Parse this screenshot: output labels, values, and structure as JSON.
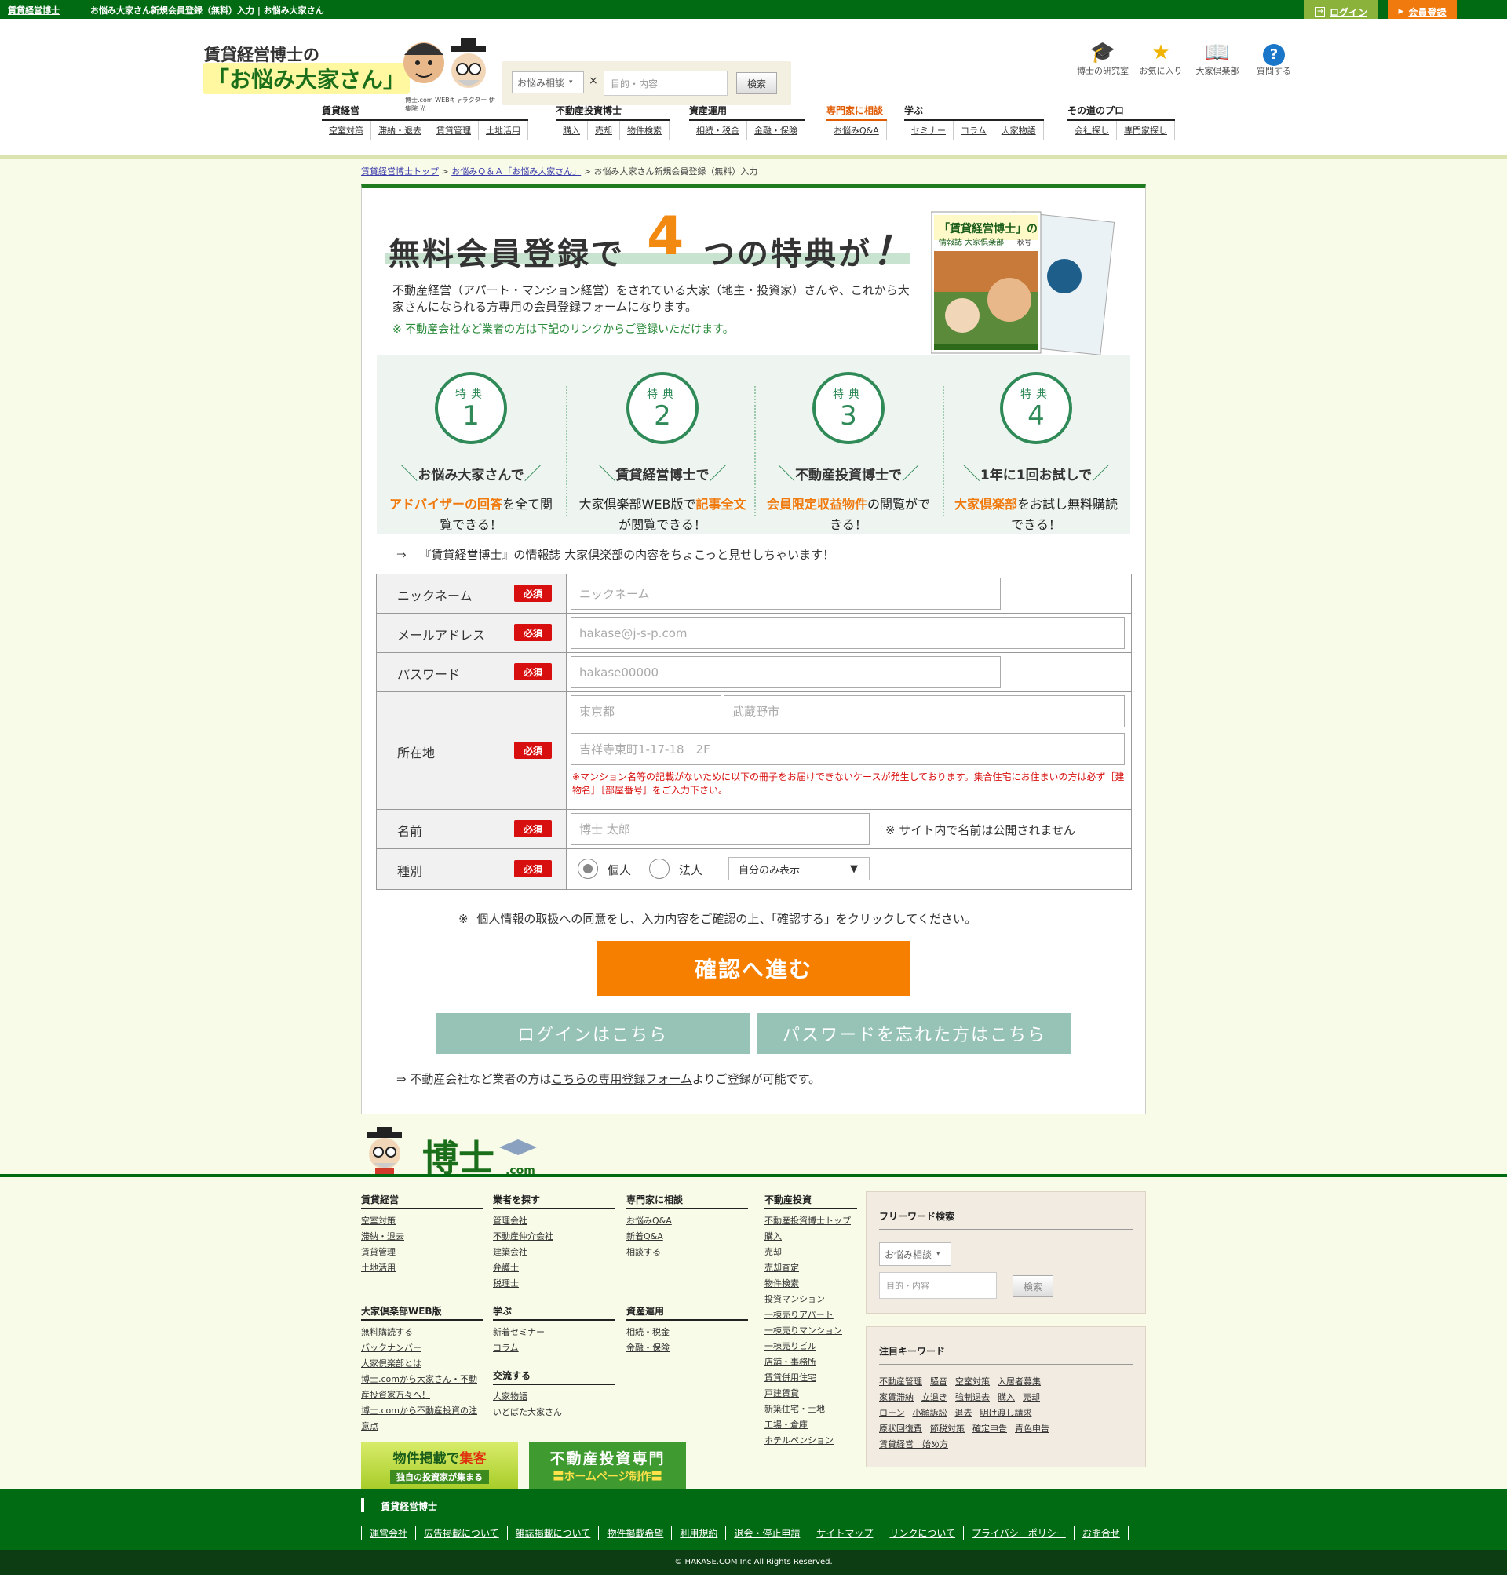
{
  "topbar": {
    "site_link": "賃貸経営博士",
    "page_title": "お悩み大家さん新規会員登録（無料）入力 | お悩み大家さん",
    "login": "ログイン",
    "register": "会員登録"
  },
  "header": {
    "logo_line1": "賃貸経営博士の",
    "logo_line2": "「お悩み大家さん」",
    "char_caption": "博士.com WEBキャラクター 伊集院 光",
    "search": {
      "select_value": "お悩み相談",
      "x_mark": "×",
      "placeholder": "目的・内容",
      "button": "検索"
    },
    "icons": [
      {
        "label": "博士の研究室",
        "icon": "mortarboard-icon"
      },
      {
        "label": "お気に入り",
        "icon": "star-icon"
      },
      {
        "label": "大家倶楽部",
        "icon": "book-icon"
      },
      {
        "label": "質問する",
        "icon": "question-icon"
      }
    ],
    "nav": [
      {
        "category": "賃貸経営",
        "items": [
          "空室対策",
          "滞納・退去",
          "賃貸管理",
          "土地活用"
        ]
      },
      {
        "category": "不動産投資博士",
        "items": [
          "購入",
          "売却",
          "物件検索"
        ]
      },
      {
        "category": "資産運用",
        "items": [
          "相続・税金",
          "金融・保険"
        ]
      },
      {
        "category": "専門家に相談",
        "items": [
          "お悩みQ&A"
        ]
      },
      {
        "category": "学ぶ",
        "items": [
          "セミナー",
          "コラム",
          "大家物語"
        ]
      },
      {
        "category": "その道のプロ",
        "items": [
          "会社探し",
          "専門家探し"
        ]
      }
    ]
  },
  "breadcrumb": {
    "home": "賃貸経営博士トップ",
    "qa": "お悩みＱ＆Ａ「お悩み大家さん」",
    "current": "お悩み大家さん新規会員登録（無料）入力",
    "sep": ">"
  },
  "hero": {
    "title_pre": "無料会員登録で",
    "title_num": "4",
    "title_post": "つの特典が",
    "title_bang": "！",
    "desc": "不動産経営（アパート・マンション経営）をされている大家（地主・投資家）さんや、これから大家さんになられる方専用の会員登録フォームになります。",
    "note": "※ 不動産会社など業者の方は下記のリンクからご登録いただけます。",
    "magazine_title": "「賃貸経営博士」の",
    "magazine_sub": "情報誌 大家倶楽部",
    "magazine_issue": "秋号"
  },
  "benefits": [
    {
      "label": "特典",
      "num": "1",
      "head": "お悩み大家さんで",
      "body_hl": "アドバイザーの回答",
      "body": "を全て閲覧できる！"
    },
    {
      "label": "特典",
      "num": "2",
      "head": "賃貸経営博士で",
      "body_pre": "大家倶楽部WEB版で",
      "body_hl": "記事全文",
      "body": "が閲覧できる！"
    },
    {
      "label": "特典",
      "num": "3",
      "head": "不動産投資博士で",
      "body_hl": "会員限定収益物件",
      "body": "の閲覧ができる！"
    },
    {
      "label": "特典",
      "num": "4",
      "head": "1年に1回お試しで",
      "body_hl": "大家倶楽部",
      "body": "をお試し無料購読できる！"
    }
  ],
  "peek": {
    "arrow": "⇒",
    "link": "『賃貸経営博士』の情報誌 大家倶楽部の内容をちょこっと見せしちゃいます！"
  },
  "form": {
    "required": "必須",
    "nickname": {
      "label": "ニックネーム",
      "placeholder": "ニックネーム"
    },
    "email": {
      "label": "メールアドレス",
      "placeholder": "hakase@j-s-p.com"
    },
    "password": {
      "label": "パスワード",
      "placeholder": "hakase00000"
    },
    "address": {
      "label": "所在地",
      "pref_placeholder": "東京都",
      "city_placeholder": "武蔵野市",
      "street_placeholder": "吉祥寺東町1-17-18　2F",
      "warning": "※マンション名等の記載がないために以下の冊子をお届けできないケースが発生しております。集合住宅にお住まいの方は必ず［建物名］［部屋番号］をご入力下さい。"
    },
    "name": {
      "label": "名前",
      "placeholder": "博士 太郎",
      "note": "※ サイト内で名前は公開されません"
    },
    "type": {
      "label": "種別",
      "opt_personal": "個人",
      "opt_corp": "法人",
      "visibility": "自分のみ表示"
    }
  },
  "agree": {
    "pre": "※",
    "link": "個人情報の取扱",
    "post": "への同意をし、入力内容をご確認の上、「確認する」をクリックしてください。"
  },
  "buttons": {
    "confirm": "確認へ進む",
    "login": "ログインはこちら",
    "forgot": "パスワードを忘れた方はこちら"
  },
  "business": {
    "pre": "⇒ 不動産会社など業者の方は",
    "link": "こちらの専用登録フォーム",
    "post": "よりご登録が可能です。"
  },
  "footer": {
    "logo_text": "博士",
    "logo_com": ".com",
    "col1": [
      {
        "title": "賃貸経営",
        "links": [
          "空室対策",
          "滞納・退去",
          "賃貸管理",
          "土地活用"
        ]
      },
      {
        "title": "大家倶楽部WEB版",
        "links": [
          "無料購読する",
          "バックナンバー",
          "大家倶楽部とは",
          "博士.comから大家さん・不動産投資家万々へ！",
          "博士.comから不動産投資の注意点"
        ]
      }
    ],
    "col2": [
      {
        "title": "業者を探す",
        "links": [
          "管理会社",
          "不動産仲介会社",
          "建築会社",
          "弁護士",
          "税理士"
        ]
      },
      {
        "title": "学ぶ",
        "links": [
          "新着セミナー",
          "コラム"
        ]
      },
      {
        "title": "交流する",
        "links": [
          "大家物語",
          "いどばた大家さん"
        ]
      }
    ],
    "col3": [
      {
        "title": "専門家に相談",
        "links": [
          "お悩みQ&A",
          "新着Q&A",
          "相談する"
        ]
      },
      {
        "title": "資産運用",
        "links": [
          "相続・税金",
          "金融・保険"
        ]
      }
    ],
    "col4": [
      {
        "title": "不動産投資",
        "links": [
          "不動産投資博士トップ",
          "購入",
          "売却",
          "売却査定",
          "物件検索",
          "投資マンション",
          "一棟売りアパート",
          "一棟売りマンション",
          "一棟売りビル",
          "店舗・事務所",
          "賃貸併用住宅",
          "戸建賃貸",
          "新築住宅・土地",
          "工場・倉庫",
          "ホテルペンション"
        ]
      }
    ],
    "freeword": {
      "title": "フリーワード検索",
      "select_value": "お悩み相談",
      "placeholder": "目的・内容",
      "button": "検索"
    },
    "keywords": {
      "title": "注目キーワード",
      "items": [
        "不動産管理",
        "騒音",
        "空室対策",
        "入居者募集",
        "家賃滞納",
        "立退き",
        "強制退去",
        "購入",
        "売却",
        "ローン",
        "小額訴訟",
        "退去",
        "明け渡し請求",
        "原状回復費",
        "節税対策",
        "確定申告",
        "青色申告",
        "賃貸経営　始め方"
      ]
    },
    "banner1": {
      "line1_pre": "物件掲載で",
      "line1_hl": "集客",
      "line2": "独自の投資家が集まる"
    },
    "banner2": {
      "line1": "不動産投資専門",
      "line2": "〓ホームページ制作〓"
    }
  },
  "bottom": {
    "title": "賃貸経営博士",
    "links": [
      "運営会社",
      "広告掲載について",
      "雑誌掲載について",
      "物件掲載希望",
      "利用規約",
      "退会・停止申請",
      "サイトマップ",
      "リンクについて",
      "プライバシーポリシー",
      "お問合せ"
    ],
    "copyright": "© HAKASE.COM Inc All Rights Reserved."
  },
  "colors": {
    "brand_green": "#006b12",
    "accent_orange": "#f77f00",
    "required_red": "#d7100f",
    "teal": "#96c3b5"
  }
}
